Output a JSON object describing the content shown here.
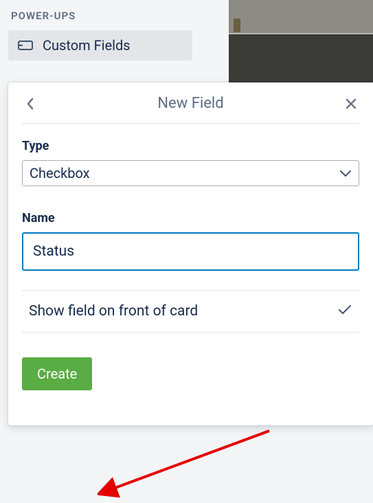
{
  "sidebar": {
    "section_label": "POWER-UPS",
    "item_label": "Custom Fields"
  },
  "modal": {
    "title": "New Field",
    "type_label": "Type",
    "type_value": "Checkbox",
    "name_label": "Name",
    "name_value": "Status",
    "show_on_front_label": "Show field on front of card",
    "create_label": "Create"
  }
}
